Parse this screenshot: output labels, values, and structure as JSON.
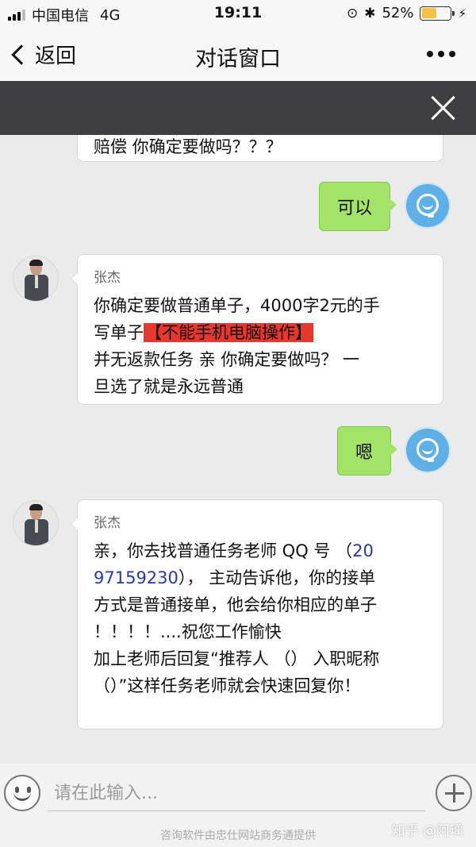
{
  "status_bar": {
    "carrier": "中国电信",
    "network": "4G",
    "time": "19:11",
    "battery": "52%",
    "battery_fill_fraction": 0.52
  },
  "nav": {
    "back_label": "返回",
    "title": "对话窗口"
  },
  "chat": {
    "partial_text": "赔偿  你确定要做吗？？？",
    "messages": [
      {
        "type": "outgoing",
        "text": "可以"
      },
      {
        "type": "incoming",
        "sender": "张杰",
        "line1": "你确定要做普通单子，4000字2元的手",
        "line2a": "写单子",
        "highlight": "【不能手机电脑操作】",
        "line3": "并无返款任务    亲 你确定要做吗？    一",
        "line4": "旦选了就是永远普通"
      },
      {
        "type": "outgoing",
        "text": "嗯"
      },
      {
        "type": "incoming",
        "sender": "张杰",
        "line1a": "亲，你去找普通任务老师  QQ 号  （",
        "qq_part1": "20",
        "qq_part2": "97159230",
        "line2b": "），  主动告诉他，你的接单",
        "line3": "方式是普通接单，他会给你相应的单子",
        "line4": "！！！！....祝您工作愉快",
        "line5": "加上老师后回复“推荐人  （）    入职昵称",
        "line6": "（）”这样任务老师就会快速回复你！"
      }
    ]
  },
  "input": {
    "placeholder": "请在此输入..."
  },
  "footer": {
    "provider_note": "咨询软件由忠仕网站商务通提供",
    "watermark": "知乎 @阿瑀"
  }
}
